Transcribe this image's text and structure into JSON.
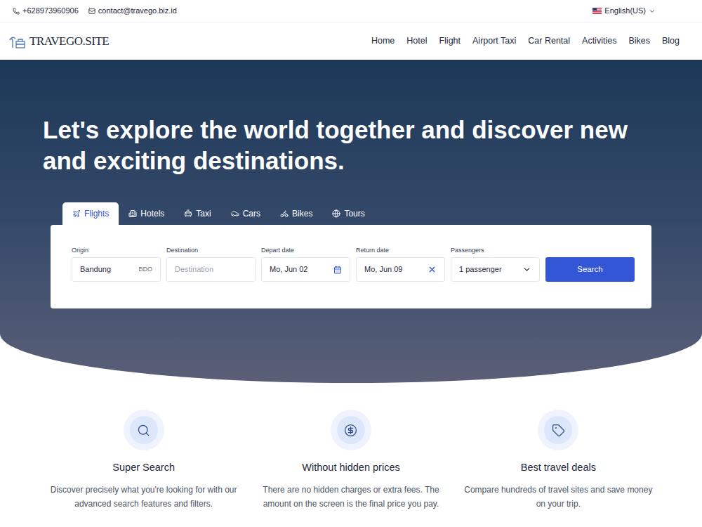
{
  "topbar": {
    "phone": "+628973960906",
    "email": "contact@travego.biz.id",
    "language": "English(US)"
  },
  "logo": {
    "text": "TRAVEGO.SITE"
  },
  "nav": [
    {
      "label": "Home"
    },
    {
      "label": "Hotel"
    },
    {
      "label": "Flight"
    },
    {
      "label": "Airport Taxi"
    },
    {
      "label": "Car Rental"
    },
    {
      "label": "Activities"
    },
    {
      "label": "Bikes"
    },
    {
      "label": "Blog"
    }
  ],
  "hero": {
    "title": "Let's explore the world together and discover new and exciting destinations."
  },
  "tabs": [
    {
      "label": "Flights",
      "selected": true
    },
    {
      "label": "Hotels",
      "selected": false
    },
    {
      "label": "Taxi",
      "selected": false
    },
    {
      "label": "Cars",
      "selected": false
    },
    {
      "label": "Bikes",
      "selected": false
    },
    {
      "label": "Tours",
      "selected": false
    }
  ],
  "search_form": {
    "origin": {
      "label": "Origin",
      "value": "Bandung",
      "code": "BDO"
    },
    "destination": {
      "label": "Destination",
      "placeholder": "Destination"
    },
    "depart": {
      "label": "Depart date",
      "value": "Mo, Jun 02"
    },
    "return": {
      "label": "Return date",
      "value": "Mo, Jun 09"
    },
    "passengers": {
      "label": "Passengers",
      "value": "1 passenger"
    },
    "button": "Search"
  },
  "features": [
    {
      "title": "Super Search",
      "description": "Discover precisely what you're looking for with our advanced search features and filters."
    },
    {
      "title": "Without hidden prices",
      "description": "There are no hidden charges or extra fees. The amount on the screen is the final price you pay."
    },
    {
      "title": "Best travel deals",
      "description": "Compare hundreds of travel sites and save money on your trip."
    }
  ]
}
